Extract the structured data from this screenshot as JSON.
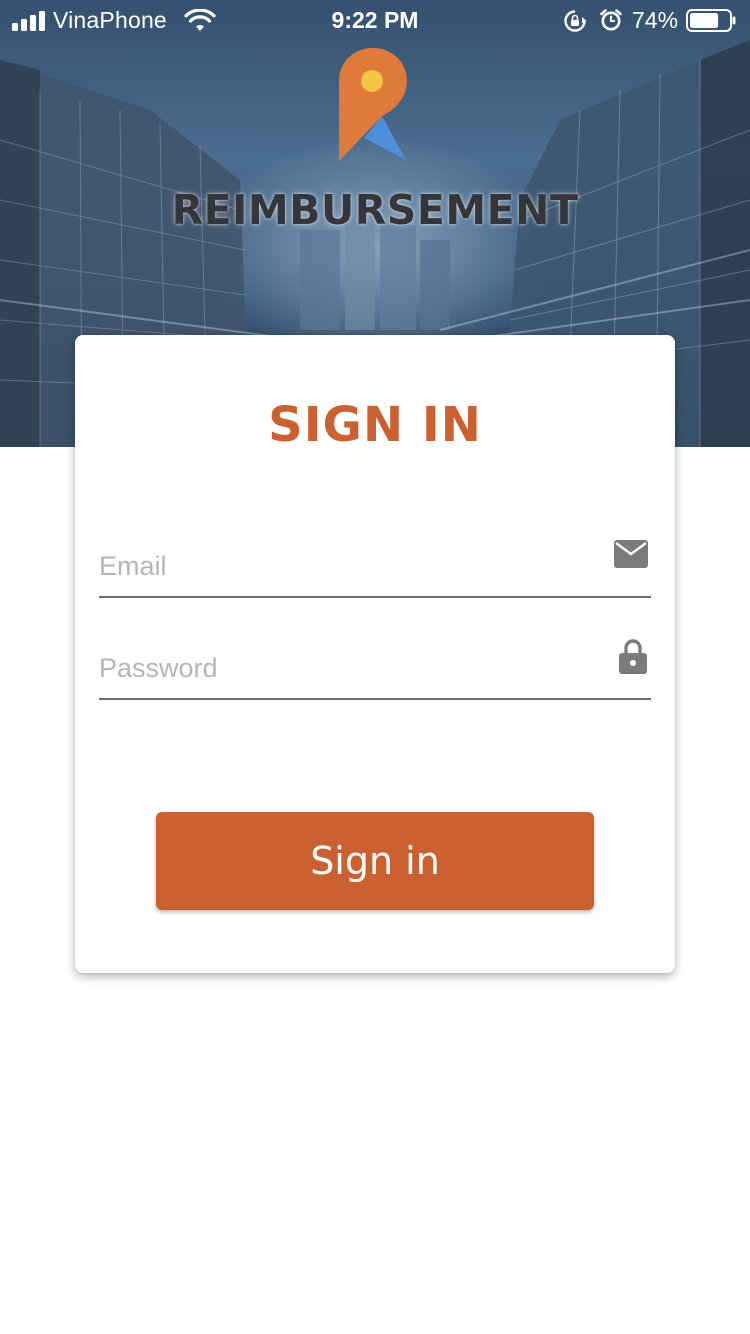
{
  "status_bar": {
    "carrier": "VinaPhone",
    "time": "9:22 PM",
    "battery_percent": "74%",
    "battery_level": 0.74,
    "signal_bars": 4,
    "icons": [
      "signal-icon",
      "wifi-icon",
      "rotation-lock-icon",
      "alarm-icon",
      "battery-icon"
    ]
  },
  "brand": {
    "name": "REIMBURSEMENT",
    "pin_color": "#e07a3b",
    "pin_dot_color": "#f4c542",
    "pin_fold_color": "#4f8fd8"
  },
  "signin": {
    "title": "SIGN IN",
    "email_placeholder": "Email",
    "email_icon": "envelope-icon",
    "password_placeholder": "Password",
    "password_icon": "lock-icon",
    "button_label": "Sign in"
  },
  "colors": {
    "accent": "#cb6130",
    "field_underline": "#6d6d6d",
    "placeholder": "#b6b6b6"
  }
}
